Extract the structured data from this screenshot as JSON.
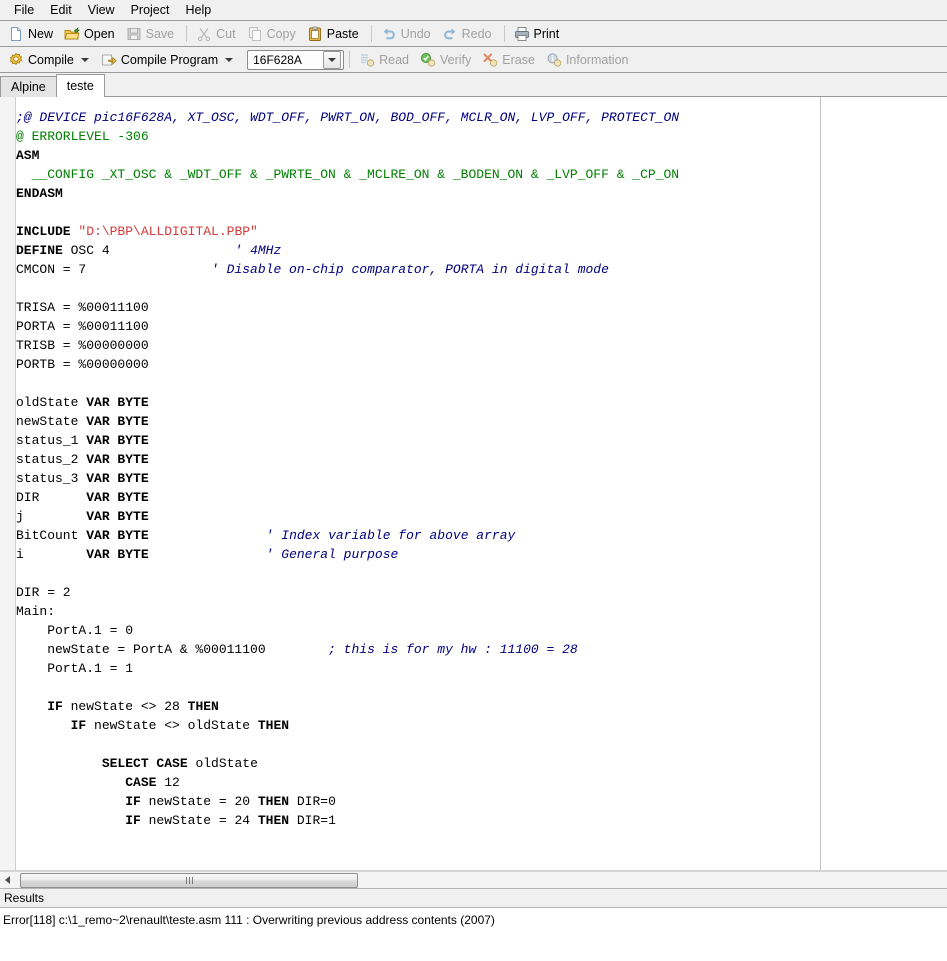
{
  "menu": {
    "items": [
      {
        "label": "File",
        "name": "menu-file"
      },
      {
        "label": "Edit",
        "name": "menu-edit"
      },
      {
        "label": "View",
        "name": "menu-view"
      },
      {
        "label": "Project",
        "name": "menu-project"
      },
      {
        "label": "Help",
        "name": "menu-help"
      }
    ]
  },
  "toolbar_main": {
    "new": "New",
    "open": "Open",
    "save": "Save",
    "cut": "Cut",
    "copy": "Copy",
    "paste": "Paste",
    "undo": "Undo",
    "redo": "Redo",
    "print": "Print"
  },
  "toolbar_compile": {
    "compile": "Compile",
    "compile_program": "Compile Program",
    "device": "16F628A",
    "read": "Read",
    "verify": "Verify",
    "erase": "Erase",
    "information": "Information"
  },
  "tabs": [
    {
      "label": "Alpine",
      "active": false
    },
    {
      "label": "teste",
      "active": true
    }
  ],
  "editor": {
    "lines": [
      {
        "segments": [
          {
            "text": ";@ DEVICE pic16F628A, XT_OSC, WDT_OFF, PWRT_ON, BOD_OFF, MCLR_ON, LVP_OFF, PROTECT_ON",
            "style": "cmt"
          }
        ]
      },
      {
        "segments": [
          {
            "text": "@ ERRORLEVEL -306",
            "style": "grn"
          }
        ]
      },
      {
        "segments": [
          {
            "text": "ASM",
            "style": "kw"
          }
        ]
      },
      {
        "segments": [
          {
            "text": "  __CONFIG _XT_OSC & _WDT_OFF & _PWRTE_ON & _MCLRE_ON & _BODEN_ON & _LVP_OFF & _CP_ON",
            "style": "grn"
          }
        ]
      },
      {
        "segments": [
          {
            "text": "ENDASM",
            "style": "kw"
          }
        ]
      },
      {
        "segments": [
          {
            "text": "",
            "style": "plain"
          }
        ]
      },
      {
        "segments": [
          {
            "text": "INCLUDE ",
            "style": "kw"
          },
          {
            "text": "\"D:\\PBP\\ALLDIGITAL.PBP\"",
            "style": "str"
          }
        ]
      },
      {
        "segments": [
          {
            "text": "DEFINE",
            "style": "kw"
          },
          {
            "text": " OSC 4                ",
            "style": "plain"
          },
          {
            "text": "' 4MHz",
            "style": "cmt"
          }
        ]
      },
      {
        "segments": [
          {
            "text": "CMCON = 7                ",
            "style": "plain"
          },
          {
            "text": "' Disable on-chip comparator, PORTA in digital mode",
            "style": "cmt"
          }
        ]
      },
      {
        "segments": [
          {
            "text": "",
            "style": "plain"
          }
        ]
      },
      {
        "segments": [
          {
            "text": "TRISA = %00011100",
            "style": "plain"
          }
        ]
      },
      {
        "segments": [
          {
            "text": "PORTA = %00011100",
            "style": "plain"
          }
        ]
      },
      {
        "segments": [
          {
            "text": "TRISB = %00000000",
            "style": "plain"
          }
        ]
      },
      {
        "segments": [
          {
            "text": "PORTB = %00000000",
            "style": "plain"
          }
        ]
      },
      {
        "segments": [
          {
            "text": "",
            "style": "plain"
          }
        ]
      },
      {
        "segments": [
          {
            "text": "oldState ",
            "style": "plain"
          },
          {
            "text": "VAR BYTE",
            "style": "kw"
          }
        ]
      },
      {
        "segments": [
          {
            "text": "newState ",
            "style": "plain"
          },
          {
            "text": "VAR BYTE",
            "style": "kw"
          }
        ]
      },
      {
        "segments": [
          {
            "text": "status_1 ",
            "style": "plain"
          },
          {
            "text": "VAR BYTE",
            "style": "kw"
          }
        ]
      },
      {
        "segments": [
          {
            "text": "status_2 ",
            "style": "plain"
          },
          {
            "text": "VAR BYTE",
            "style": "kw"
          }
        ]
      },
      {
        "segments": [
          {
            "text": "status_3 ",
            "style": "plain"
          },
          {
            "text": "VAR BYTE",
            "style": "kw"
          }
        ]
      },
      {
        "segments": [
          {
            "text": "DIR      ",
            "style": "plain"
          },
          {
            "text": "VAR BYTE",
            "style": "kw"
          }
        ]
      },
      {
        "segments": [
          {
            "text": "j        ",
            "style": "plain"
          },
          {
            "text": "VAR BYTE",
            "style": "kw"
          }
        ]
      },
      {
        "segments": [
          {
            "text": "BitCount ",
            "style": "plain"
          },
          {
            "text": "VAR BYTE",
            "style": "kw"
          },
          {
            "text": "               ",
            "style": "plain"
          },
          {
            "text": "' Index variable for above array",
            "style": "cmt"
          }
        ]
      },
      {
        "segments": [
          {
            "text": "i        ",
            "style": "plain"
          },
          {
            "text": "VAR BYTE",
            "style": "kw"
          },
          {
            "text": "               ",
            "style": "plain"
          },
          {
            "text": "' General purpose",
            "style": "cmt"
          }
        ]
      },
      {
        "segments": [
          {
            "text": "",
            "style": "plain"
          }
        ]
      },
      {
        "segments": [
          {
            "text": "DIR = 2",
            "style": "plain"
          }
        ]
      },
      {
        "segments": [
          {
            "text": "Main:",
            "style": "plain"
          }
        ]
      },
      {
        "segments": [
          {
            "text": "    PortA.1 = 0",
            "style": "plain"
          }
        ]
      },
      {
        "segments": [
          {
            "text": "    newState = PortA & %00011100        ",
            "style": "plain"
          },
          {
            "text": "; this is for my hw : 11100 = 28",
            "style": "cmt"
          }
        ]
      },
      {
        "segments": [
          {
            "text": "    PortA.1 = 1",
            "style": "plain"
          }
        ]
      },
      {
        "segments": [
          {
            "text": "",
            "style": "plain"
          }
        ]
      },
      {
        "segments": [
          {
            "text": "    ",
            "style": "plain"
          },
          {
            "text": "IF",
            "style": "kw"
          },
          {
            "text": " newState <> 28 ",
            "style": "plain"
          },
          {
            "text": "THEN",
            "style": "kw"
          }
        ]
      },
      {
        "segments": [
          {
            "text": "       ",
            "style": "plain"
          },
          {
            "text": "IF",
            "style": "kw"
          },
          {
            "text": " newState <> oldState ",
            "style": "plain"
          },
          {
            "text": "THEN",
            "style": "kw"
          }
        ]
      },
      {
        "segments": [
          {
            "text": "",
            "style": "plain"
          }
        ]
      },
      {
        "segments": [
          {
            "text": "           ",
            "style": "plain"
          },
          {
            "text": "SELECT CASE",
            "style": "kw"
          },
          {
            "text": " oldState",
            "style": "plain"
          }
        ]
      },
      {
        "segments": [
          {
            "text": "              ",
            "style": "plain"
          },
          {
            "text": "CASE",
            "style": "kw"
          },
          {
            "text": " 12",
            "style": "plain"
          }
        ]
      },
      {
        "segments": [
          {
            "text": "              ",
            "style": "plain"
          },
          {
            "text": "IF",
            "style": "kw"
          },
          {
            "text": " newState = 20 ",
            "style": "plain"
          },
          {
            "text": "THEN",
            "style": "kw"
          },
          {
            "text": " DIR=0",
            "style": "plain"
          }
        ]
      },
      {
        "segments": [
          {
            "text": "              ",
            "style": "plain"
          },
          {
            "text": "IF",
            "style": "kw"
          },
          {
            "text": " newState = 24 ",
            "style": "plain"
          },
          {
            "text": "THEN",
            "style": "kw"
          },
          {
            "text": " DIR=1",
            "style": "plain"
          }
        ]
      }
    ]
  },
  "results": {
    "header": "Results",
    "lines": [
      "Error[118] c:\\1_remo~2\\renault\\teste.asm 111 : Overwriting previous address contents (2007)"
    ]
  },
  "colors": {
    "comment": "#00007f",
    "keyword": "#000000",
    "directive": "#007f00",
    "string": "#d63b3b",
    "toolbar_bg": "#f0f0f0",
    "editor_bg": "#ffffff"
  }
}
